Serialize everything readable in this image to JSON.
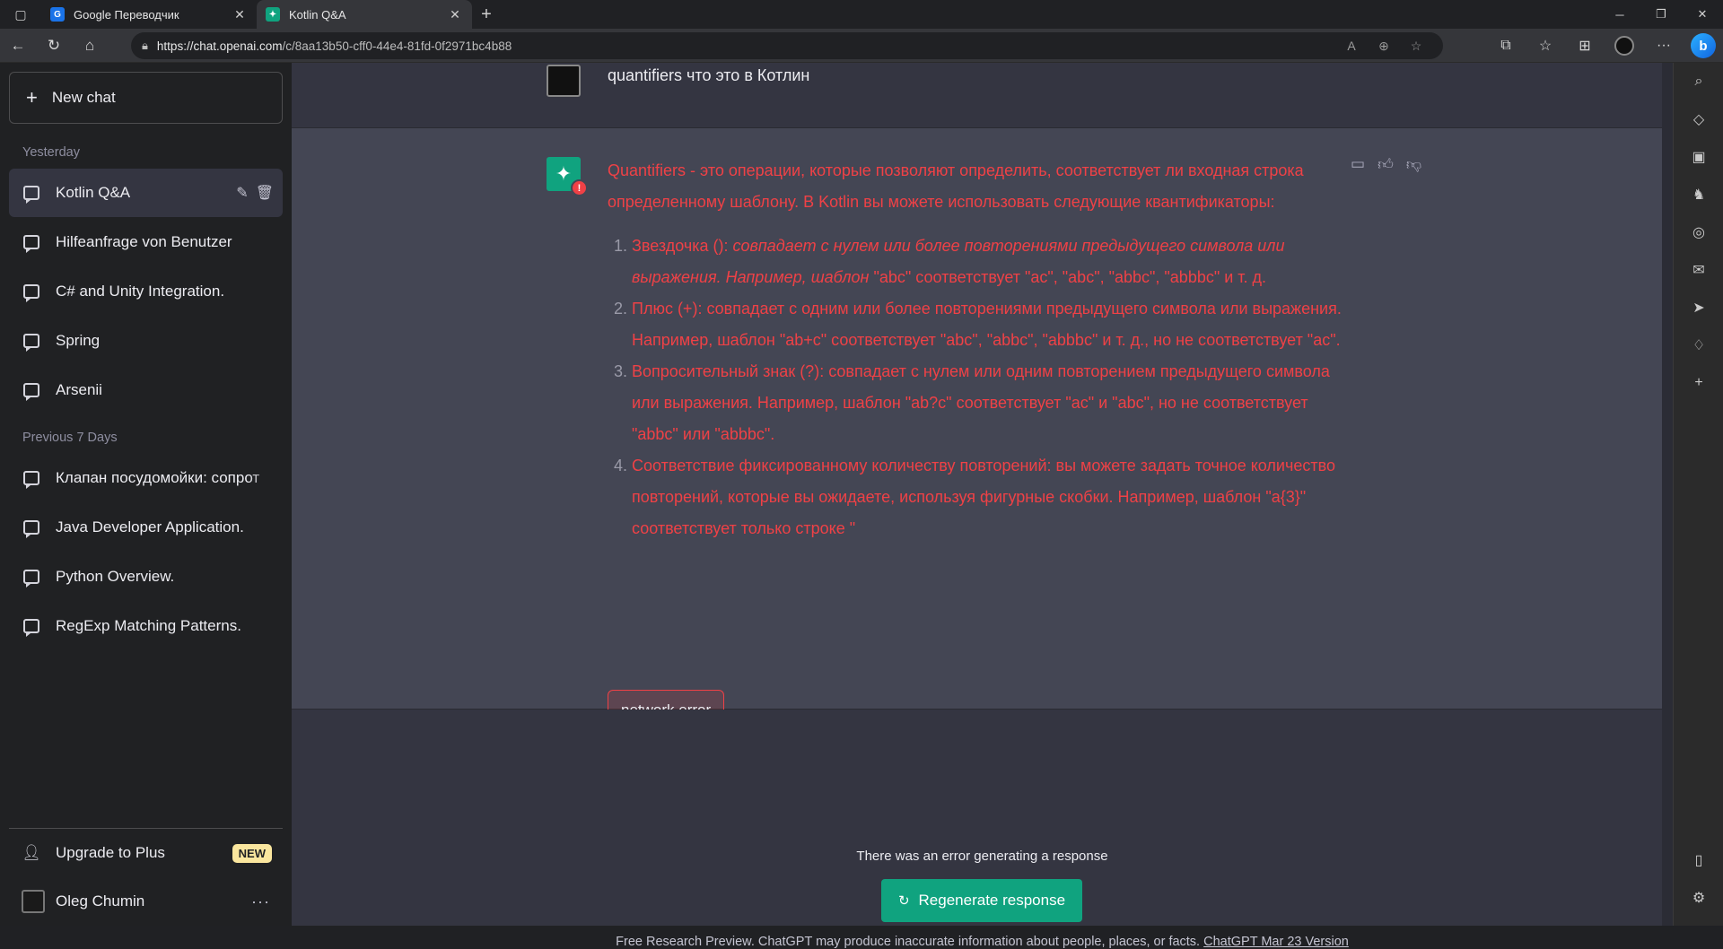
{
  "browser": {
    "tabs": [
      {
        "label": "Google Переводчик",
        "favicon_color": "#1a73e8",
        "favicon_char": "G"
      },
      {
        "label": "Kotlin Q&A",
        "favicon_color": "#10a37f",
        "favicon_char": "✦"
      }
    ],
    "url_host": "https://chat.openai.com",
    "url_path": "/c/8aa13b50-cff0-44e4-81fd-0f2971bc4b88"
  },
  "sidebar": {
    "new_chat": "New chat",
    "sections": [
      {
        "label": "Yesterday",
        "items": [
          "Kotlin Q&A",
          "Hilfeanfrage von Benutzer",
          "C# and Unity Integration.",
          "Spring",
          "Arsenii"
        ]
      },
      {
        "label": "Previous 7 Days",
        "items": [
          "Клапан посудомойки: сопрот",
          "Java Developer Application.",
          "Python Overview.",
          "RegExp Matching Patterns."
        ]
      }
    ],
    "upgrade": "Upgrade to Plus",
    "new_badge": "NEW",
    "user_name": "Oleg Chumin"
  },
  "chat": {
    "user_message": "quantifiers что это в Котлин",
    "bot_intro": "Quantifiers - это операции, которые позволяют определить, соответствует ли входная строка определенному шаблону. В Kotlin вы можете использовать следующие квантификаторы:",
    "list": [
      {
        "lead": "Звездочка (): ",
        "italic": "совпадает с нулем или более повторениями предыдущего символа или выражения. Например, шаблон ",
        "rest": "\"abc\" соответствует \"ac\", \"abc\", \"abbc\", \"abbbc\" и т. д."
      },
      {
        "lead": "Плюс (+): ",
        "italic": "",
        "rest": "совпадает с одним или более повторениями предыдущего символа или выражения. Например, шаблон \"ab+c\" соответствует \"abc\", \"abbc\", \"abbbc\" и т. д., но не соответствует \"ac\"."
      },
      {
        "lead": "Вопросительный знак (?): ",
        "italic": "",
        "rest": "совпадает с нулем или одним повторением предыдущего символа или выражения. Например, шаблон \"ab?c\" соответствует \"ac\" и \"abc\", но не соответствует \"abbc\" или \"abbbc\"."
      },
      {
        "lead": "Соответствие фиксированному количеству повторений: ",
        "italic": "",
        "rest": "вы можете задать точное количество повторений, которые вы ожидаете, используя фигурные скобки. Например, шаблон \"a{3}\" соответствует только строке \""
      }
    ],
    "network_error": "network error",
    "error_text": "There was an error generating a response",
    "regenerate": "Regenerate response",
    "footer_text": "Free Research Preview. ChatGPT may produce inaccurate information about people, places, or facts. ",
    "footer_link": "ChatGPT Mar 23 Version"
  },
  "colors": {
    "accent": "#10a37f",
    "error": "#ef4146"
  }
}
